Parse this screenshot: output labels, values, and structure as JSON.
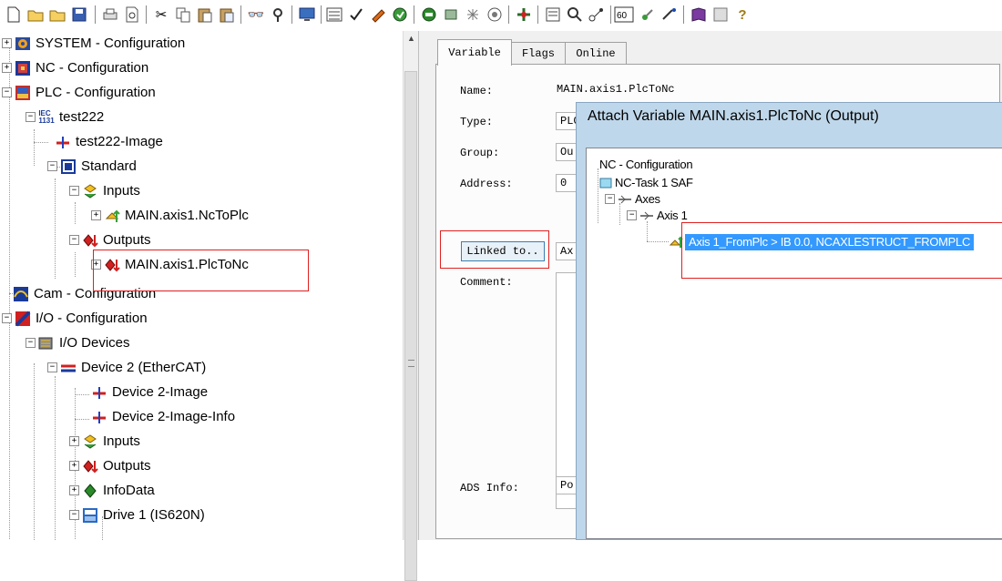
{
  "toolbar": {
    "icons": [
      "new-file",
      "open-folder",
      "open-folder-2",
      "save",
      "print",
      "print-preview",
      "cut",
      "copy",
      "paste",
      "paste-special",
      "find",
      "find-next",
      "monitor",
      "generate-mappings",
      "check-config",
      "activate-config",
      "restart",
      "toggle-free-run",
      "scan-devices",
      "show-online",
      "show-variables",
      "zoom",
      "network",
      "freerun",
      "target",
      "debug",
      "book",
      "help"
    ]
  },
  "tree": {
    "items": [
      {
        "label": "SYSTEM - Configuration",
        "icon": "system-icon"
      },
      {
        "label": "NC - Configuration",
        "icon": "nc-icon"
      },
      {
        "label": "PLC - Configuration",
        "icon": "plc-icon"
      },
      {
        "label": "test222",
        "icon": "iec-icon"
      },
      {
        "label": "test222-Image",
        "icon": "image-icon"
      },
      {
        "label": "Standard",
        "icon": "task-icon"
      },
      {
        "label": "Inputs",
        "icon": "inputs-icon"
      },
      {
        "label": "MAIN.axis1.NcToPlc",
        "icon": "var-in-icon"
      },
      {
        "label": "Outputs",
        "icon": "outputs-icon"
      },
      {
        "label": "MAIN.axis1.PlcToNc",
        "icon": "var-out-icon"
      },
      {
        "label": "Cam - Configuration",
        "icon": "cam-icon"
      },
      {
        "label": "I/O - Configuration",
        "icon": "io-icon"
      },
      {
        "label": "I/O Devices",
        "icon": "io-devices-icon"
      },
      {
        "label": "Device 2 (EtherCAT)",
        "icon": "ethercat-icon"
      },
      {
        "label": "Device 2-Image",
        "icon": "image-icon"
      },
      {
        "label": "Device 2-Image-Info",
        "icon": "image-icon"
      },
      {
        "label": "Inputs",
        "icon": "inputs-icon"
      },
      {
        "label": "Outputs",
        "icon": "outputs-icon"
      },
      {
        "label": "InfoData",
        "icon": "infodata-icon"
      },
      {
        "label": "Drive 1 (IS620N)",
        "icon": "drive-icon"
      }
    ],
    "iec_badge": "IEC\n1131"
  },
  "tabs": [
    {
      "label": "Variable"
    },
    {
      "label": "Flags"
    },
    {
      "label": "Online"
    }
  ],
  "form": {
    "name_label": "Name:",
    "name_value": "MAIN.axis1.PlcToNc",
    "type_label": "Type:",
    "type_value": "PLC",
    "group_label": "Group:",
    "group_value": "Ou",
    "address_label": "Address:",
    "address_value": "0",
    "linked_button": "Linked to..",
    "linked_value": "Ax",
    "comment_label": "Comment:",
    "ads_label": "ADS Info:",
    "ads_value": "Po"
  },
  "dialog": {
    "title": "Attach Variable MAIN.axis1.PlcToNc (Output)",
    "tree": [
      {
        "label": "NC - Configuration"
      },
      {
        "label": "NC-Task 1 SAF"
      },
      {
        "label": "Axes"
      },
      {
        "label": "Axis 1"
      },
      {
        "label": "Axis 1_FromPlc   >   IB 0.0, NCAXLESTRUCT_FROMPLC"
      }
    ]
  },
  "colors": {
    "highlight": "#3399ff",
    "annotation": "#e02020",
    "dialog_frame": "#bfd7ea"
  }
}
